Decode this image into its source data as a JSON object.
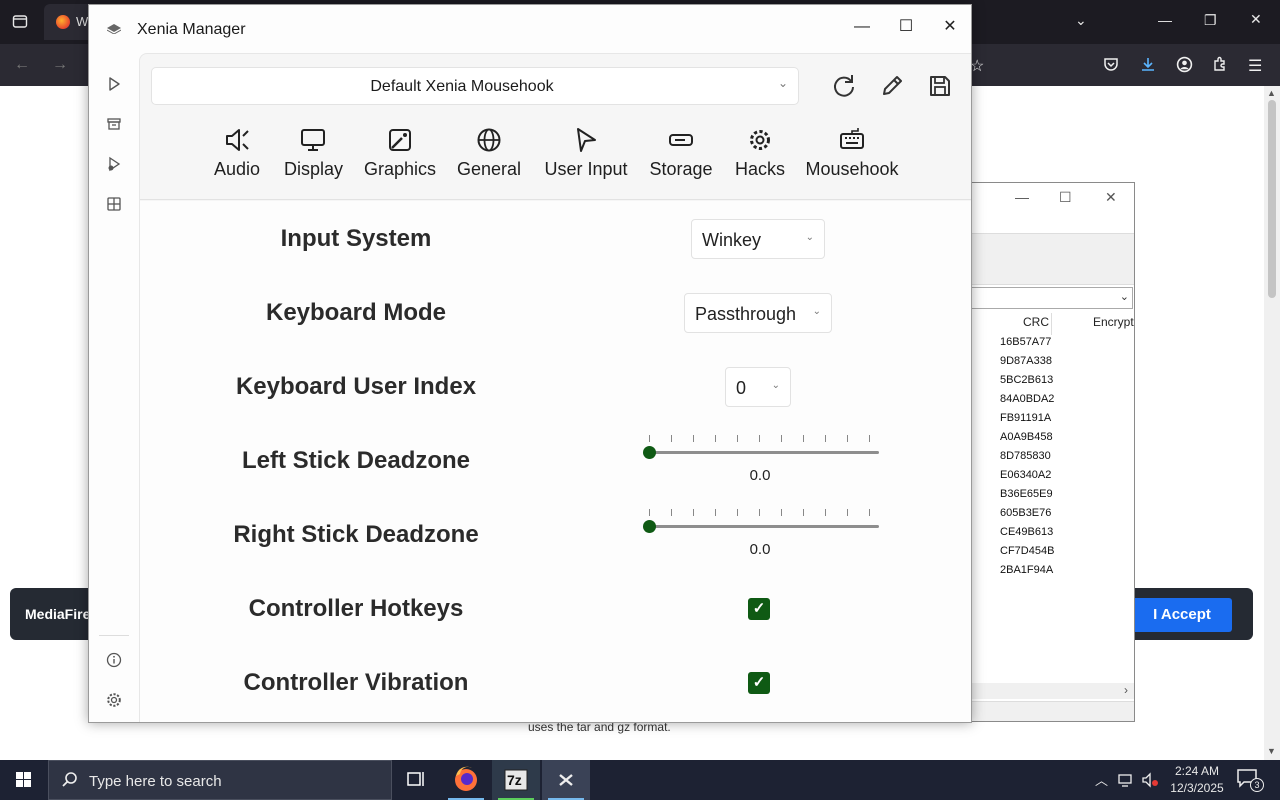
{
  "browser": {
    "tab_title": "W",
    "banner_text": "MediaFire r",
    "accept_label": "I Accept",
    "page_note": "uses the tar and gz format."
  },
  "zip_window": {
    "col_crc": "CRC",
    "col_encrypted": "Encrypt",
    "crc_values": [
      "16B57A77",
      "9D87A338",
      "5BC2B613",
      "84A0BDA2",
      "FB91191A",
      "A0A9B458",
      "8D785830",
      "E06340A2",
      "B36E65E9",
      "605B3E76",
      "CE49B613",
      "CF7D454B",
      "2BA1F94A"
    ]
  },
  "xenia": {
    "title": "Xenia Manager",
    "profile": "Default Xenia Mousehook",
    "categories": [
      {
        "label": "Audio",
        "icon": "speaker-icon"
      },
      {
        "label": "Display",
        "icon": "monitor-icon"
      },
      {
        "label": "Graphics",
        "icon": "image-edit-icon"
      },
      {
        "label": "General",
        "icon": "globe-icon"
      },
      {
        "label": "User Input",
        "icon": "cursor-icon"
      },
      {
        "label": "Storage",
        "icon": "drive-icon"
      },
      {
        "label": "Hacks",
        "icon": "gear-icon"
      },
      {
        "label": "Mousehook",
        "icon": "keyboard-icon"
      }
    ],
    "settings": {
      "input_system": {
        "label": "Input System",
        "value": "Winkey"
      },
      "keyboard_mode": {
        "label": "Keyboard Mode",
        "value": "Passthrough"
      },
      "keyboard_user_index": {
        "label": "Keyboard User Index",
        "value": "0"
      },
      "left_stick_deadzone": {
        "label": "Left Stick Deadzone",
        "value": "0.0"
      },
      "right_stick_deadzone": {
        "label": "Right Stick Deadzone",
        "value": "0.0"
      },
      "controller_hotkeys": {
        "label": "Controller Hotkeys",
        "checked": true
      },
      "controller_vibration": {
        "label": "Controller Vibration",
        "checked": true
      }
    },
    "accent_color": "#0f5a14"
  },
  "taskbar": {
    "search_placeholder": "Type here to search",
    "time": "2:24 AM",
    "date": "12/3/2025",
    "notification_count": "3",
    "sevenzip_label": "7z"
  }
}
